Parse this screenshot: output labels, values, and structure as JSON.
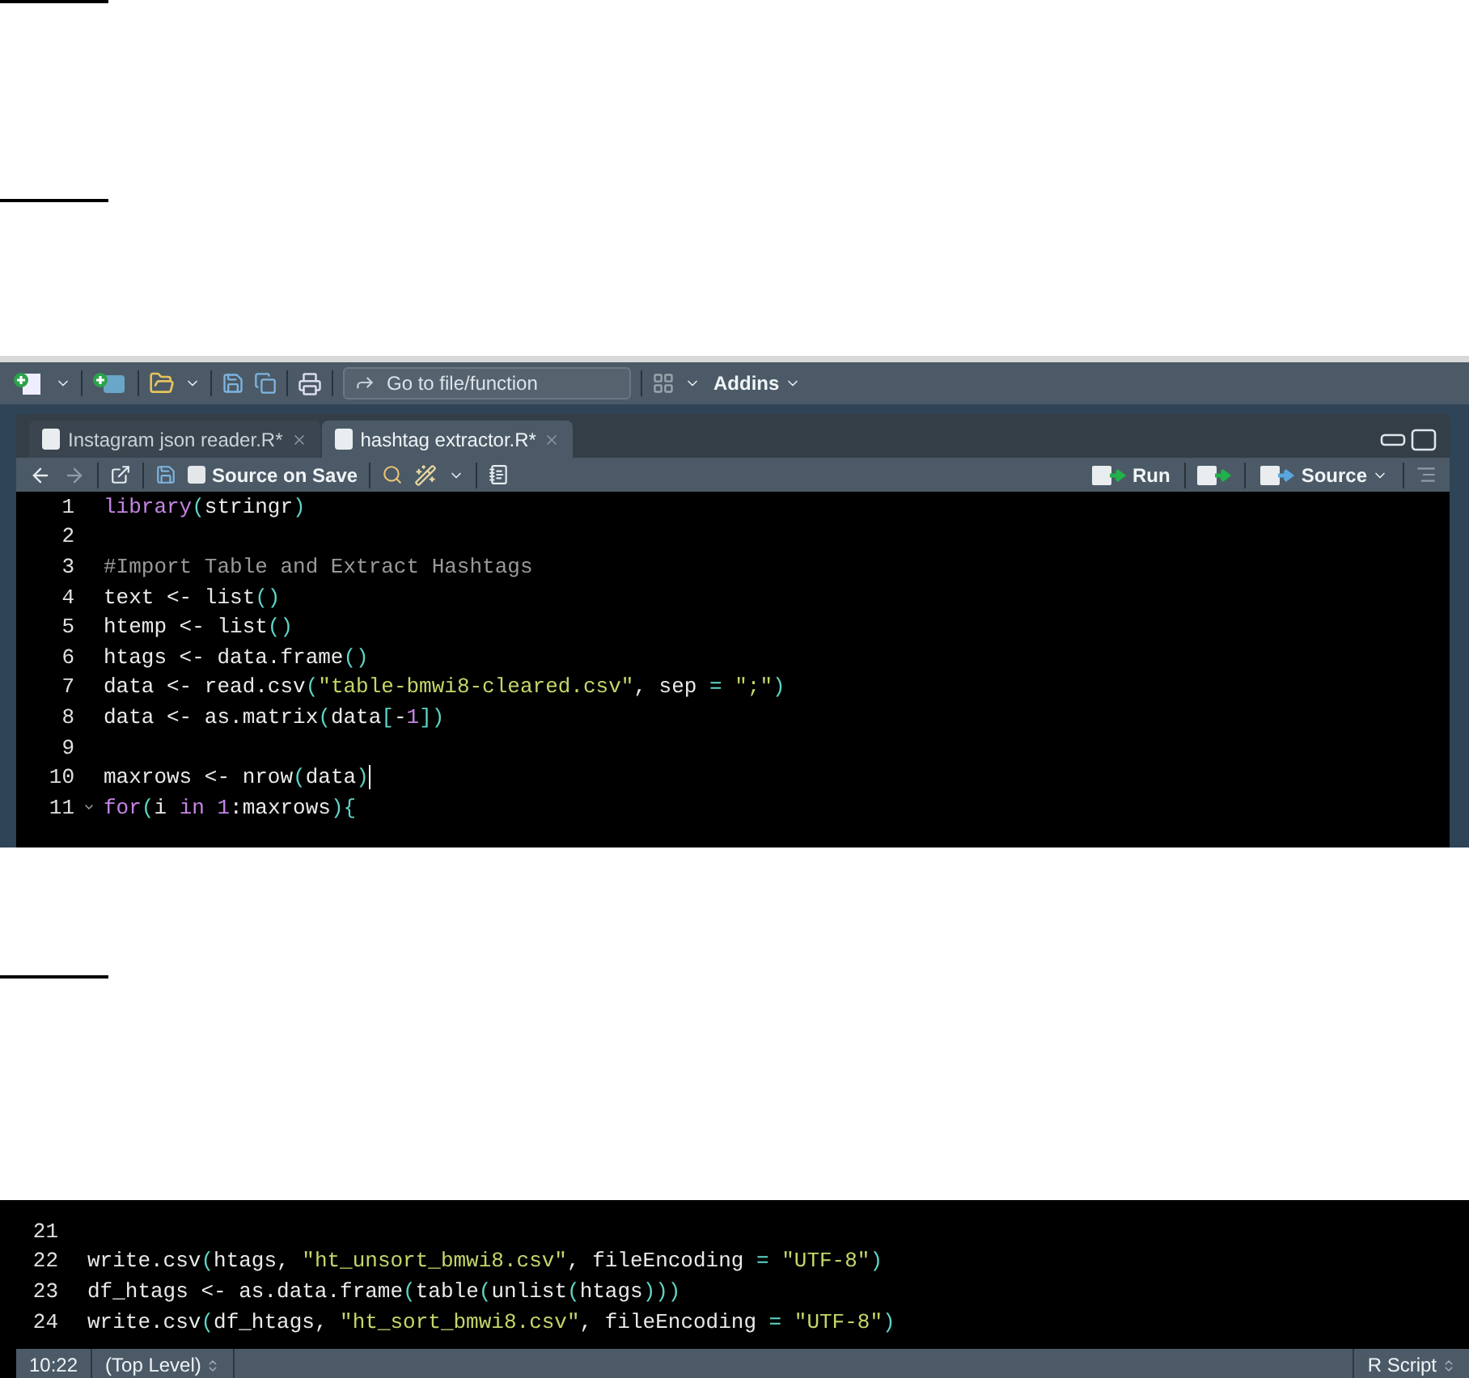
{
  "editor_top": {
    "main_toolbar": {
      "goto_placeholder": "Go to file/function",
      "addins": "Addins"
    },
    "tabs": [
      {
        "label": "Instagram json reader.R*",
        "selected": false
      },
      {
        "label": "hashtag extractor.R*",
        "selected": true
      }
    ],
    "source_toolbar": {
      "source_on_save": {
        "label": "Source on Save",
        "checked": false
      },
      "run": "Run",
      "source": "Source"
    },
    "lines": [
      {
        "number": "1",
        "cursor": false,
        "foldable": false,
        "tokens": [
          {
            "kind": "keyword",
            "text": "library"
          },
          {
            "kind": "paren",
            "text": "("
          },
          {
            "kind": "plain",
            "text": "stringr"
          },
          {
            "kind": "paren",
            "text": ")"
          }
        ]
      },
      {
        "number": "2",
        "cursor": false,
        "foldable": false
      },
      {
        "number": "3",
        "cursor": false,
        "foldable": false,
        "tokens": [
          {
            "kind": "comment",
            "text": "#Import Table and Extract Hashtags"
          }
        ]
      },
      {
        "number": "4",
        "cursor": false,
        "foldable": false,
        "tokens": [
          {
            "kind": "plain",
            "text": "text <- list"
          },
          {
            "kind": "paren",
            "text": "()"
          }
        ]
      },
      {
        "number": "5",
        "cursor": false,
        "foldable": false,
        "tokens": [
          {
            "kind": "plain",
            "text": "htemp <- list"
          },
          {
            "kind": "paren",
            "text": "()"
          }
        ]
      },
      {
        "number": "6",
        "cursor": false,
        "foldable": false,
        "tokens": [
          {
            "kind": "plain",
            "text": "htags <- data.frame"
          },
          {
            "kind": "paren",
            "text": "()"
          }
        ]
      },
      {
        "number": "7",
        "cursor": false,
        "foldable": false,
        "tokens": [
          {
            "kind": "plain",
            "text": "data <- read.csv"
          },
          {
            "kind": "paren",
            "text": "("
          },
          {
            "kind": "string",
            "text": "\"table-bmwi8-cleared.csv\""
          },
          {
            "kind": "plain",
            "text": ", sep"
          },
          {
            "kind": "op",
            "text": " = "
          },
          {
            "kind": "string",
            "text": "\";\""
          },
          {
            "kind": "paren",
            "text": ")"
          }
        ]
      },
      {
        "number": "8",
        "cursor": false,
        "foldable": false,
        "tokens": [
          {
            "kind": "plain",
            "text": "data <- as.matrix"
          },
          {
            "kind": "paren",
            "text": "("
          },
          {
            "kind": "plain",
            "text": "data"
          },
          {
            "kind": "paren",
            "text": "["
          },
          {
            "kind": "plain",
            "text": "-"
          },
          {
            "kind": "number",
            "text": "1"
          },
          {
            "kind": "paren",
            "text": "])"
          }
        ]
      },
      {
        "number": "9",
        "cursor": false,
        "foldable": false
      },
      {
        "number": "10",
        "cursor": true,
        "foldable": false,
        "tokens": [
          {
            "kind": "plain",
            "text": "maxrows <- nrow"
          },
          {
            "kind": "paren",
            "text": "("
          },
          {
            "kind": "plain",
            "text": "data"
          },
          {
            "kind": "paren",
            "text": ")"
          }
        ]
      },
      {
        "number": "11",
        "cursor": false,
        "foldable": true,
        "tokens": [
          {
            "kind": "keyword",
            "text": "for"
          },
          {
            "kind": "paren",
            "text": "("
          },
          {
            "kind": "plain",
            "text": "i "
          },
          {
            "kind": "keyword",
            "text": "in "
          },
          {
            "kind": "number",
            "text": "1"
          },
          {
            "kind": "plain",
            "text": ":maxrows"
          },
          {
            "kind": "paren",
            "text": "){"
          }
        ]
      }
    ]
  },
  "editor_bottom": {
    "lines": [
      {
        "number": "21",
        "cursor": false,
        "foldable": false
      },
      {
        "number": "22",
        "cursor": false,
        "foldable": false,
        "tokens": [
          {
            "kind": "plain",
            "text": "write.csv"
          },
          {
            "kind": "paren",
            "text": "("
          },
          {
            "kind": "plain",
            "text": "htags, "
          },
          {
            "kind": "string",
            "text": "\"ht_unsort_bmwi8.csv\""
          },
          {
            "kind": "plain",
            "text": ", fileEncoding"
          },
          {
            "kind": "op",
            "text": " = "
          },
          {
            "kind": "string",
            "text": "\"UTF-8\""
          },
          {
            "kind": "paren",
            "text": ")"
          }
        ]
      },
      {
        "number": "23",
        "cursor": false,
        "foldable": false,
        "tokens": [
          {
            "kind": "plain",
            "text": "df_htags <- as.data.frame"
          },
          {
            "kind": "paren",
            "text": "("
          },
          {
            "kind": "plain",
            "text": "table"
          },
          {
            "kind": "paren",
            "text": "("
          },
          {
            "kind": "plain",
            "text": "unlist"
          },
          {
            "kind": "paren",
            "text": "("
          },
          {
            "kind": "plain",
            "text": "htags"
          },
          {
            "kind": "paren",
            "text": ")))"
          }
        ]
      },
      {
        "number": "24",
        "cursor": false,
        "foldable": false,
        "tokens": [
          {
            "kind": "plain",
            "text": "write.csv"
          },
          {
            "kind": "paren",
            "text": "("
          },
          {
            "kind": "plain",
            "text": "df_htags, "
          },
          {
            "kind": "string",
            "text": "\"ht_sort_bmwi8.csv\""
          },
          {
            "kind": "plain",
            "text": ", fileEncoding"
          },
          {
            "kind": "op",
            "text": " = "
          },
          {
            "kind": "string",
            "text": "\"UTF-8\""
          },
          {
            "kind": "paren",
            "text": ")"
          }
        ]
      }
    ],
    "status_bar": {
      "position": "10:22",
      "scope": "(Top Level)",
      "file_type": "R Script"
    }
  }
}
